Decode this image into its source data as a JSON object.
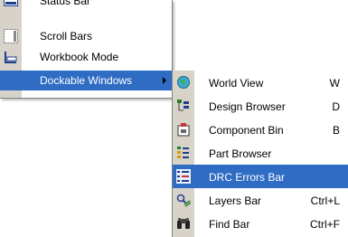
{
  "menu": {
    "items": [
      {
        "label": "Status Bar",
        "icon": "status-bar-icon"
      },
      {
        "label": "Scroll Bars",
        "icon": "scroll-bars-icon"
      },
      {
        "label": "Workbook Mode",
        "icon": "workbook-mode-icon"
      },
      {
        "label": "Dockable Windows",
        "icon": "",
        "selected": true
      }
    ]
  },
  "submenu": {
    "items": [
      {
        "label": "World View",
        "shortcut": "W",
        "icon": "world-view-icon"
      },
      {
        "label": "Design Browser",
        "shortcut": "D",
        "icon": "design-browser-icon"
      },
      {
        "label": "Component Bin",
        "shortcut": "B",
        "icon": "component-bin-icon"
      },
      {
        "label": "Part Browser",
        "shortcut": "",
        "icon": "part-browser-icon"
      },
      {
        "label": "DRC Errors Bar",
        "shortcut": "",
        "icon": "drc-errors-bar-icon",
        "selected": true
      },
      {
        "label": "Layers Bar",
        "shortcut": "Ctrl+L",
        "icon": "layers-bar-icon"
      },
      {
        "label": "Find Bar",
        "shortcut": "Ctrl+F",
        "icon": "find-bar-icon"
      }
    ]
  },
  "colors": {
    "highlight": "#2f6cc4",
    "strip": "#d8d3c8",
    "border": "#848484"
  }
}
